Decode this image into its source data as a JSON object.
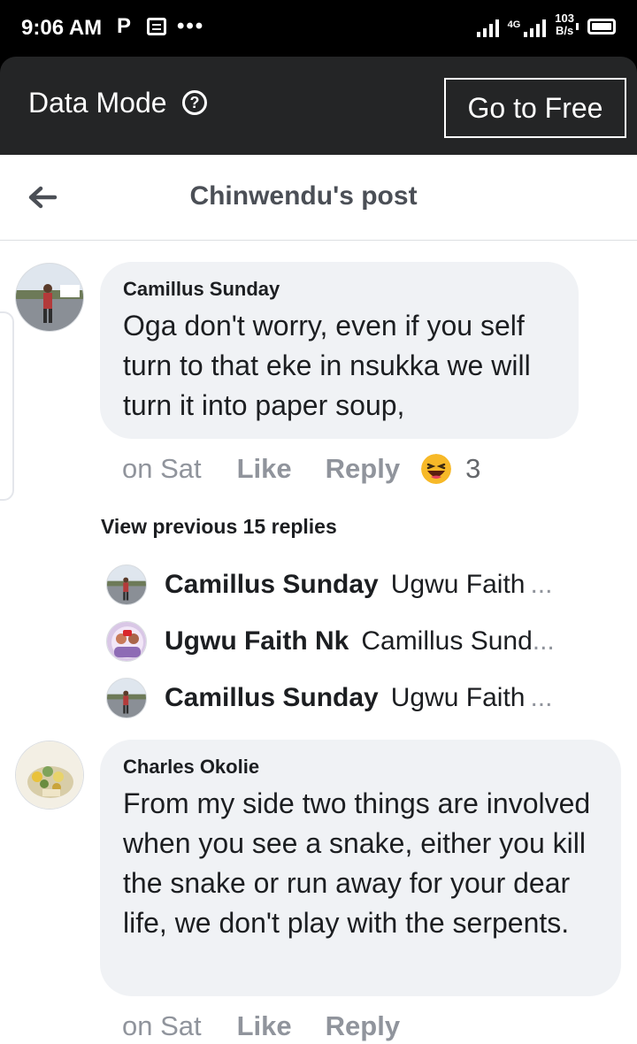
{
  "status_bar": {
    "time": "9:06 AM",
    "network": "4G",
    "speed_value": "103",
    "speed_unit": "B/s"
  },
  "data_mode": {
    "label": "Data Mode",
    "help_icon": "?",
    "button_label": "Go to Free"
  },
  "header": {
    "title": "Chinwendu's post",
    "back_icon": "arrow-left-icon"
  },
  "comments": [
    {
      "author": "Camillus Sunday",
      "text": "Oga don't worry, even if you self turn to that eke in nsukka we will turn it into paper soup,",
      "time": "on Sat",
      "like_label": "Like",
      "reply_label": "Reply",
      "reaction_icon": "haha-emoji-icon",
      "reaction_count": "3"
    },
    {
      "author": "Charles Okolie",
      "text": "From my side two things are involved when you see a snake, either you kill the snake or run away for your dear life, we don't play with the serpents.",
      "time": "on Sat",
      "like_label": "Like",
      "reply_label": "Reply"
    }
  ],
  "replies": {
    "view_previous": "View previous 15 replies",
    "items": [
      {
        "author": "Camillus Sunday",
        "text": "Ugwu Faith"
      },
      {
        "author": "Ugwu Faith Nk",
        "text": "Camillus Sund"
      },
      {
        "author": "Camillus Sunday",
        "text": "Ugwu Faith"
      }
    ],
    "ellipsis": "..."
  },
  "colors": {
    "accent_bar": "#242526",
    "bubble": "#f0f2f5",
    "muted_text": "#90949c",
    "reaction": "#f7b928"
  }
}
